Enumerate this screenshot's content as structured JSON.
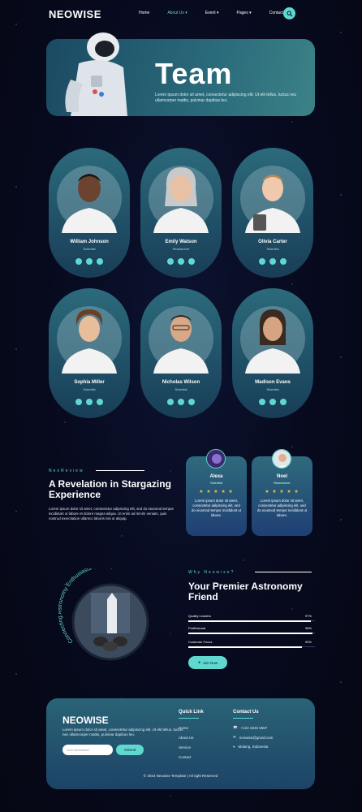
{
  "brand": {
    "logo": "NEOWISE"
  },
  "nav": {
    "items": [
      {
        "label": "Home"
      },
      {
        "label": "About Us"
      },
      {
        "label": "Event"
      },
      {
        "label": "Pages"
      },
      {
        "label": "Contact Us"
      }
    ],
    "active": "About Us",
    "search_icon": "search-icon"
  },
  "hero": {
    "title": "Team",
    "description": "Lorem ipsum dolor sit amet, consectetur adipiscing elit. Ut elit tellus, luctus nec ullamcorper mattis, pulvinar dapibus leo."
  },
  "team": [
    {
      "name": "William Johnson",
      "role": "Scientist"
    },
    {
      "name": "Emily Watson",
      "role": "Researcher"
    },
    {
      "name": "Olivia Carter",
      "role": "Scientist"
    },
    {
      "name": "Sophia Miller",
      "role": "Scientist"
    },
    {
      "name": "Nicholas Wilson",
      "role": "Scientist"
    },
    {
      "name": "Madison Evans",
      "role": "Scientist"
    }
  ],
  "review": {
    "tag": "NeoReview",
    "title": "A Revelation in Stargazing Experience",
    "text": "Lorem ipsum dolor sit amet, consectetur adipiscing elit, sed do eiusmod tempor incididunt ut labore et dolore magna aliqua. Ut enim ad minim veniam, quis nostrud exercitation ullamco laboris nisi ut aliquip.",
    "cards": [
      {
        "name": "Alexa",
        "role": "Scientist",
        "stars": "★ ★ ★ ★ ★",
        "quote": "Lorem ipsum dolor sit amet, consectetur adipiscing elit, sed do eiusmod tempor incididunt ut labore."
      },
      {
        "name": "Noel",
        "role": "Researcher",
        "stars": "★ ★ ★ ★ ★",
        "quote": "Lorem ipsum dolor sit amet, consectetur adipiscing elit, sed do eiusmod tempor incididunt ut labore."
      }
    ]
  },
  "why": {
    "circle_text": "Connecting Astronomy Enthusiasts Globally",
    "tag": "Why Neowise?",
    "title": "Your Premier Astronomy Friend",
    "bars": [
      {
        "label": "Quality Leaders",
        "value": "97%",
        "fraction": 0.97
      },
      {
        "label": "Proffesional",
        "value": "98%",
        "fraction": 0.98
      },
      {
        "label": "Customer Focus",
        "value": "90%",
        "fraction": 0.9
      }
    ],
    "button": "Join Now"
  },
  "footer": {
    "logo": "NEOWISE",
    "description": "Lorem ipsum dolor sit amet, consectetur adipiscing elit. Ut elit tellus, luctus nec ullamcorper mattis, pulvinar dapibus leo.",
    "newsletter_placeholder": "Your Newsletter",
    "send_label": "Send",
    "quick_link_title": "Quick Link",
    "quick_links": [
      "Home",
      "About Us",
      "Service",
      "Contact"
    ],
    "contact_title": "Contact Us",
    "contacts": [
      "+122 3345 5567",
      "neowise@gmail.com",
      "Malang, Indonesia"
    ],
    "copyright": "© 2024 Neowise Template | All right Reserved"
  },
  "colors": {
    "accent": "#5fd9d0",
    "card": "#2c6a7b",
    "background": "#070a1d",
    "star": "#f2c23e"
  }
}
